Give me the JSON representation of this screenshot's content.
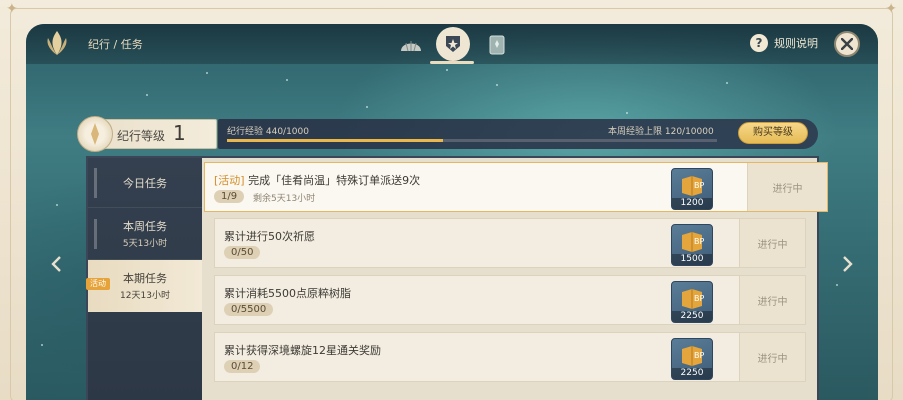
{
  "header": {
    "breadcrumb": "纪行 / 任务",
    "help_label": "规则说明"
  },
  "level": {
    "label": "纪行等级",
    "value": "1"
  },
  "exp": {
    "label": "纪行经验 440/1000",
    "progress_fraction": 0.44,
    "weekly_cap_label": "本周经验上限 120/10000",
    "buy_button_label": "购买等级"
  },
  "sidebar": {
    "items": [
      {
        "title": "今日任务",
        "sub": ""
      },
      {
        "title": "本周任务",
        "sub": "5天13小时"
      },
      {
        "title": "本期任务",
        "sub": "12天13小时",
        "tag": "活动"
      }
    ]
  },
  "tasks": [
    {
      "prefix": "[活动]",
      "title": " 完成「佳肴尚温」特殊订单派送9次",
      "progress": "1/9",
      "remain": "剩余5天13小时",
      "reward": "1200",
      "status": "进行中"
    },
    {
      "prefix": "",
      "title": "累计进行50次祈愿",
      "progress": "0/50",
      "remain": "",
      "reward": "1500",
      "status": "进行中"
    },
    {
      "prefix": "",
      "title": "累计消耗5500点原粹树脂",
      "progress": "0/5500",
      "remain": "",
      "reward": "2250",
      "status": "进行中"
    },
    {
      "prefix": "",
      "title": "累计获得深境螺旋12星通关奖励",
      "progress": "0/12",
      "remain": "",
      "reward": "2250",
      "status": "进行中"
    }
  ],
  "colors": {
    "accent_gold": "#e9b74c",
    "activity_tag": "#e6a33a",
    "panel_teal": "#3f7d83"
  }
}
